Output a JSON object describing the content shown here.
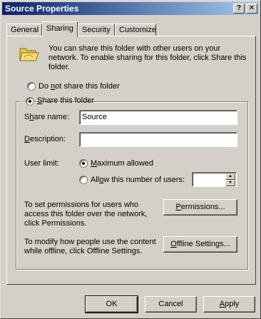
{
  "window": {
    "title": "Source Properties",
    "help_glyph": "?",
    "close_glyph": "✕"
  },
  "tabs": [
    {
      "label": "General"
    },
    {
      "label": "Sharing"
    },
    {
      "label": "Security"
    },
    {
      "label": "Customize"
    }
  ],
  "sharing": {
    "intro": "You can share this folder with other users on your network. To enable sharing for this folder, click Share this folder.",
    "do_not_share": {
      "prefix": "Do ",
      "accel": "n",
      "rest": "ot share this folder",
      "selected": false
    },
    "share": {
      "prefix": "",
      "accel": "S",
      "rest": "hare this folder",
      "selected": true
    },
    "share_name": {
      "prefix": "S",
      "accel": "h",
      "rest": "are name:",
      "value": "Source"
    },
    "description": {
      "prefix": "",
      "accel": "D",
      "rest": "escription:",
      "value": ""
    },
    "user_limit": {
      "label": "User limit:",
      "maximum": {
        "prefix": "",
        "accel": "M",
        "rest": "aximum allowed",
        "selected": true
      },
      "allow": {
        "prefix": "All",
        "accel": "o",
        "rest": "w this number of users:",
        "selected": false
      },
      "count": ""
    },
    "permissions_text": "To set permissions for users who access this folder over the network, click Permissions.",
    "permissions_button": {
      "prefix": "",
      "accel": "P",
      "rest": "ermissions..."
    },
    "offline_text": "To modify how people use the content while offline, click Offline Settings.",
    "offline_button": {
      "prefix": "",
      "accel": "O",
      "rest": "ffline Settings..."
    }
  },
  "footer": {
    "ok": "OK",
    "cancel": "Cancel",
    "apply": {
      "prefix": "",
      "accel": "A",
      "rest": "pply"
    }
  }
}
